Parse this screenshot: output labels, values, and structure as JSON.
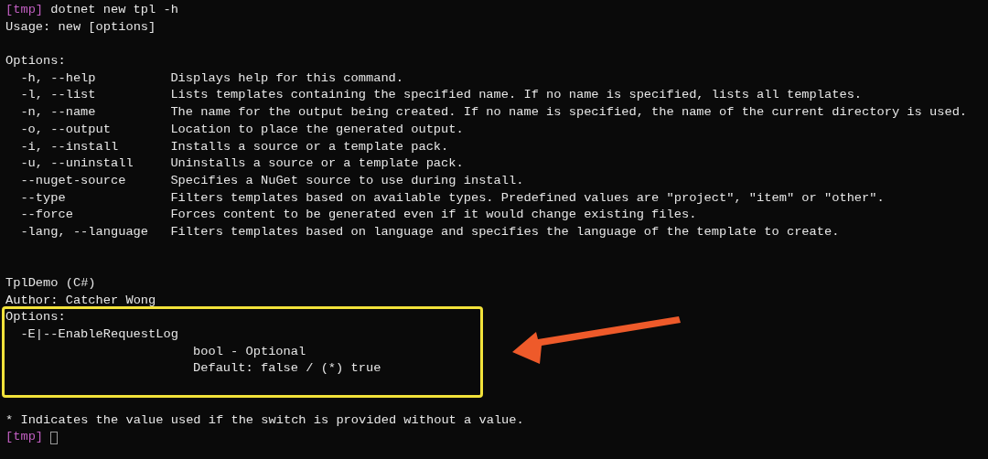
{
  "prompt": {
    "label": "[tmp]",
    "command": "dotnet new tpl -h"
  },
  "usage": "Usage: new [options]",
  "options_heading": "Options:",
  "options": [
    {
      "flag": "-h, --help",
      "description": "Displays help for this command."
    },
    {
      "flag": "-l, --list",
      "description": "Lists templates containing the specified name. If no name is specified, lists all templates."
    },
    {
      "flag": "-n, --name",
      "description": "The name for the output being created. If no name is specified, the name of the current directory is used."
    },
    {
      "flag": "-o, --output",
      "description": "Location to place the generated output."
    },
    {
      "flag": "-i, --install",
      "description": "Installs a source or a template pack."
    },
    {
      "flag": "-u, --uninstall",
      "description": "Uninstalls a source or a template pack."
    },
    {
      "flag": "--nuget-source",
      "description": "Specifies a NuGet source to use during install."
    },
    {
      "flag": "--type",
      "description": "Filters templates based on available types. Predefined values are \"project\", \"item\" or \"other\"."
    },
    {
      "flag": "--force",
      "description": "Forces content to be generated even if it would change existing files."
    },
    {
      "flag": "-lang, --language",
      "description": "Filters templates based on language and specifies the language of the template to create."
    }
  ],
  "template": {
    "title": "TplDemo (C#)",
    "author": "Author: Catcher Wong",
    "options_heading": "Options:",
    "parameters": [
      {
        "flag": "-E|--EnableRequestLog",
        "type": "bool - Optional",
        "default": "Default: false / (*) true"
      }
    ]
  },
  "footnote": "* Indicates the value used if the switch is provided without a value.",
  "final_prompt": {
    "label": "[tmp]"
  }
}
